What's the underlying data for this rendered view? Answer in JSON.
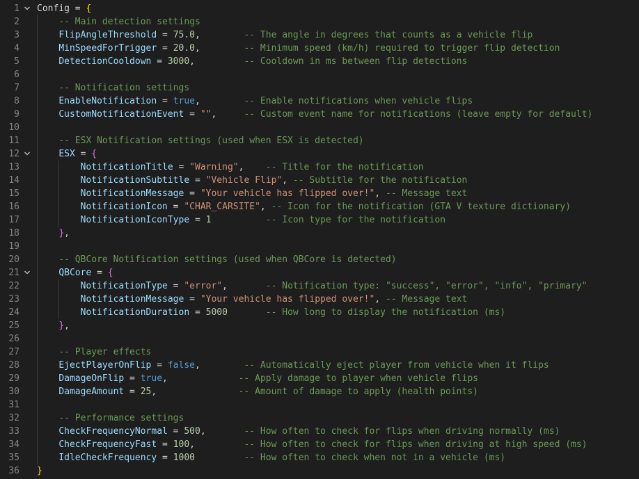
{
  "editor": {
    "language": "lua",
    "lines": [
      {
        "n": "1",
        "fold": true,
        "tokens": [
          {
            "t": "top",
            "v": "Config"
          },
          {
            "t": "op",
            "v": " = "
          },
          {
            "t": "b1",
            "v": "{"
          }
        ]
      },
      {
        "n": "2",
        "tokens": [
          {
            "t": "op",
            "v": "    "
          },
          {
            "t": "cm",
            "v": "-- Main detection settings"
          }
        ]
      },
      {
        "n": "3",
        "tokens": [
          {
            "t": "op",
            "v": "    "
          },
          {
            "t": "id",
            "v": "FlipAngleThreshold"
          },
          {
            "t": "op",
            "v": " = "
          },
          {
            "t": "num",
            "v": "75.0"
          },
          {
            "t": "op",
            "v": ",        "
          },
          {
            "t": "cm",
            "v": "-- The angle in degrees that counts as a vehicle flip"
          }
        ]
      },
      {
        "n": "4",
        "tokens": [
          {
            "t": "op",
            "v": "    "
          },
          {
            "t": "id",
            "v": "MinSpeedForTrigger"
          },
          {
            "t": "op",
            "v": " = "
          },
          {
            "t": "num",
            "v": "20.0"
          },
          {
            "t": "op",
            "v": ",        "
          },
          {
            "t": "cm",
            "v": "-- Minimum speed (km/h) required to trigger flip detection"
          }
        ]
      },
      {
        "n": "5",
        "tokens": [
          {
            "t": "op",
            "v": "    "
          },
          {
            "t": "id",
            "v": "DetectionCooldown"
          },
          {
            "t": "op",
            "v": " = "
          },
          {
            "t": "num",
            "v": "3000"
          },
          {
            "t": "op",
            "v": ",         "
          },
          {
            "t": "cm",
            "v": "-- Cooldown in ms between flip detections"
          }
        ]
      },
      {
        "n": "6",
        "tokens": []
      },
      {
        "n": "7",
        "tokens": [
          {
            "t": "op",
            "v": "    "
          },
          {
            "t": "cm",
            "v": "-- Notification settings"
          }
        ]
      },
      {
        "n": "8",
        "tokens": [
          {
            "t": "op",
            "v": "    "
          },
          {
            "t": "id",
            "v": "EnableNotification"
          },
          {
            "t": "op",
            "v": " = "
          },
          {
            "t": "kw",
            "v": "true"
          },
          {
            "t": "op",
            "v": ",        "
          },
          {
            "t": "cm",
            "v": "-- Enable notifications when vehicle flips"
          }
        ]
      },
      {
        "n": "9",
        "tokens": [
          {
            "t": "op",
            "v": "    "
          },
          {
            "t": "id",
            "v": "CustomNotificationEvent"
          },
          {
            "t": "op",
            "v": " = "
          },
          {
            "t": "str",
            "v": "\"\""
          },
          {
            "t": "op",
            "v": ",     "
          },
          {
            "t": "cm",
            "v": "-- Custom event name for notifications (leave empty for default)"
          }
        ]
      },
      {
        "n": "10",
        "tokens": []
      },
      {
        "n": "11",
        "tokens": [
          {
            "t": "op",
            "v": "    "
          },
          {
            "t": "cm",
            "v": "-- ESX Notification settings (used when ESX is detected)"
          }
        ]
      },
      {
        "n": "12",
        "fold": true,
        "tokens": [
          {
            "t": "op",
            "v": "    "
          },
          {
            "t": "id",
            "v": "ESX"
          },
          {
            "t": "op",
            "v": " = "
          },
          {
            "t": "b2",
            "v": "{"
          }
        ]
      },
      {
        "n": "13",
        "tokens": [
          {
            "t": "op",
            "v": "        "
          },
          {
            "t": "id",
            "v": "NotificationTitle"
          },
          {
            "t": "op",
            "v": " = "
          },
          {
            "t": "str",
            "v": "\"Warning\""
          },
          {
            "t": "op",
            "v": ",    "
          },
          {
            "t": "cm",
            "v": "-- Title for the notification"
          }
        ]
      },
      {
        "n": "14",
        "tokens": [
          {
            "t": "op",
            "v": "        "
          },
          {
            "t": "id",
            "v": "NotificationSubtitle"
          },
          {
            "t": "op",
            "v": " = "
          },
          {
            "t": "str",
            "v": "\"Vehicle Flip\""
          },
          {
            "t": "op",
            "v": ", "
          },
          {
            "t": "cm",
            "v": "-- Subtitle for the notification"
          }
        ]
      },
      {
        "n": "15",
        "tokens": [
          {
            "t": "op",
            "v": "        "
          },
          {
            "t": "id",
            "v": "NotificationMessage"
          },
          {
            "t": "op",
            "v": " = "
          },
          {
            "t": "str",
            "v": "\"Your vehicle has flipped over!\""
          },
          {
            "t": "op",
            "v": ", "
          },
          {
            "t": "cm",
            "v": "-- Message text"
          }
        ]
      },
      {
        "n": "16",
        "tokens": [
          {
            "t": "op",
            "v": "        "
          },
          {
            "t": "id",
            "v": "NotificationIcon"
          },
          {
            "t": "op",
            "v": " = "
          },
          {
            "t": "str",
            "v": "\"CHAR_CARSITE\""
          },
          {
            "t": "op",
            "v": ", "
          },
          {
            "t": "cm",
            "v": "-- Icon for the notification (GTA V texture dictionary)"
          }
        ]
      },
      {
        "n": "17",
        "tokens": [
          {
            "t": "op",
            "v": "        "
          },
          {
            "t": "id",
            "v": "NotificationIconType"
          },
          {
            "t": "op",
            "v": " = "
          },
          {
            "t": "num",
            "v": "1"
          },
          {
            "t": "op",
            "v": "          "
          },
          {
            "t": "cm",
            "v": "-- Icon type for the notification"
          }
        ]
      },
      {
        "n": "18",
        "tokens": [
          {
            "t": "op",
            "v": "    "
          },
          {
            "t": "b2",
            "v": "}"
          },
          {
            "t": "op",
            "v": ","
          }
        ]
      },
      {
        "n": "19",
        "tokens": []
      },
      {
        "n": "20",
        "tokens": [
          {
            "t": "op",
            "v": "    "
          },
          {
            "t": "cm",
            "v": "-- QBCore Notification settings (used when QBCore is detected)"
          }
        ]
      },
      {
        "n": "21",
        "fold": true,
        "tokens": [
          {
            "t": "op",
            "v": "    "
          },
          {
            "t": "id",
            "v": "QBCore"
          },
          {
            "t": "op",
            "v": " = "
          },
          {
            "t": "b2",
            "v": "{"
          }
        ]
      },
      {
        "n": "22",
        "tokens": [
          {
            "t": "op",
            "v": "        "
          },
          {
            "t": "id",
            "v": "NotificationType"
          },
          {
            "t": "op",
            "v": " = "
          },
          {
            "t": "str",
            "v": "\"error\""
          },
          {
            "t": "op",
            "v": ",       "
          },
          {
            "t": "cm",
            "v": "-- Notification type: \"success\", \"error\", \"info\", \"primary\""
          }
        ]
      },
      {
        "n": "23",
        "tokens": [
          {
            "t": "op",
            "v": "        "
          },
          {
            "t": "id",
            "v": "NotificationMessage"
          },
          {
            "t": "op",
            "v": " = "
          },
          {
            "t": "str",
            "v": "\"Your vehicle has flipped over!\""
          },
          {
            "t": "op",
            "v": ", "
          },
          {
            "t": "cm",
            "v": "-- Message text"
          }
        ]
      },
      {
        "n": "24",
        "tokens": [
          {
            "t": "op",
            "v": "        "
          },
          {
            "t": "id",
            "v": "NotificationDuration"
          },
          {
            "t": "op",
            "v": " = "
          },
          {
            "t": "num",
            "v": "5000"
          },
          {
            "t": "op",
            "v": "       "
          },
          {
            "t": "cm",
            "v": "-- How long to display the notification (ms)"
          }
        ]
      },
      {
        "n": "25",
        "tokens": [
          {
            "t": "op",
            "v": "    "
          },
          {
            "t": "b2",
            "v": "}"
          },
          {
            "t": "op",
            "v": ","
          }
        ]
      },
      {
        "n": "26",
        "tokens": []
      },
      {
        "n": "27",
        "tokens": [
          {
            "t": "op",
            "v": "    "
          },
          {
            "t": "cm",
            "v": "-- Player effects"
          }
        ]
      },
      {
        "n": "28",
        "tokens": [
          {
            "t": "op",
            "v": "    "
          },
          {
            "t": "id",
            "v": "EjectPlayerOnFlip"
          },
          {
            "t": "op",
            "v": " = "
          },
          {
            "t": "kw",
            "v": "false"
          },
          {
            "t": "op",
            "v": ",        "
          },
          {
            "t": "cm",
            "v": "-- Automatically eject player from vehicle when it flips"
          }
        ]
      },
      {
        "n": "29",
        "tokens": [
          {
            "t": "op",
            "v": "    "
          },
          {
            "t": "id",
            "v": "DamageOnFlip"
          },
          {
            "t": "op",
            "v": " = "
          },
          {
            "t": "kw",
            "v": "true"
          },
          {
            "t": "op",
            "v": ",             "
          },
          {
            "t": "cm",
            "v": "-- Apply damage to player when vehicle flips"
          }
        ]
      },
      {
        "n": "30",
        "tokens": [
          {
            "t": "op",
            "v": "    "
          },
          {
            "t": "id",
            "v": "DamageAmount"
          },
          {
            "t": "op",
            "v": " = "
          },
          {
            "t": "num",
            "v": "25"
          },
          {
            "t": "op",
            "v": ",               "
          },
          {
            "t": "cm",
            "v": "-- Amount of damage to apply (health points)"
          }
        ]
      },
      {
        "n": "31",
        "tokens": []
      },
      {
        "n": "32",
        "tokens": [
          {
            "t": "op",
            "v": "    "
          },
          {
            "t": "cm",
            "v": "-- Performance settings"
          }
        ]
      },
      {
        "n": "33",
        "tokens": [
          {
            "t": "op",
            "v": "    "
          },
          {
            "t": "id",
            "v": "CheckFrequencyNormal"
          },
          {
            "t": "op",
            "v": " = "
          },
          {
            "t": "num",
            "v": "500"
          },
          {
            "t": "op",
            "v": ",       "
          },
          {
            "t": "cm",
            "v": "-- How often to check for flips when driving normally (ms)"
          }
        ]
      },
      {
        "n": "34",
        "tokens": [
          {
            "t": "op",
            "v": "    "
          },
          {
            "t": "id",
            "v": "CheckFrequencyFast"
          },
          {
            "t": "op",
            "v": " = "
          },
          {
            "t": "num",
            "v": "100"
          },
          {
            "t": "op",
            "v": ",         "
          },
          {
            "t": "cm",
            "v": "-- How often to check for flips when driving at high speed (ms)"
          }
        ]
      },
      {
        "n": "35",
        "tokens": [
          {
            "t": "op",
            "v": "    "
          },
          {
            "t": "id",
            "v": "IdleCheckFrequency"
          },
          {
            "t": "op",
            "v": " = "
          },
          {
            "t": "num",
            "v": "1000"
          },
          {
            "t": "op",
            "v": "         "
          },
          {
            "t": "cm",
            "v": "-- How often to check when not in a vehicle (ms)"
          }
        ]
      },
      {
        "n": "36",
        "tokens": [
          {
            "t": "b1",
            "v": "}"
          }
        ]
      }
    ]
  },
  "icons": {
    "fold": "chevron-down-icon"
  },
  "colors": {
    "background": "#1e1e1e",
    "line_number": "#858585",
    "identifier": "#9cdcfe",
    "number": "#b5cea8",
    "string": "#ce9178",
    "keyword": "#569cd6",
    "comment": "#6a9955",
    "bracket_level1": "#ffd700",
    "bracket_level2": "#da70d6"
  }
}
